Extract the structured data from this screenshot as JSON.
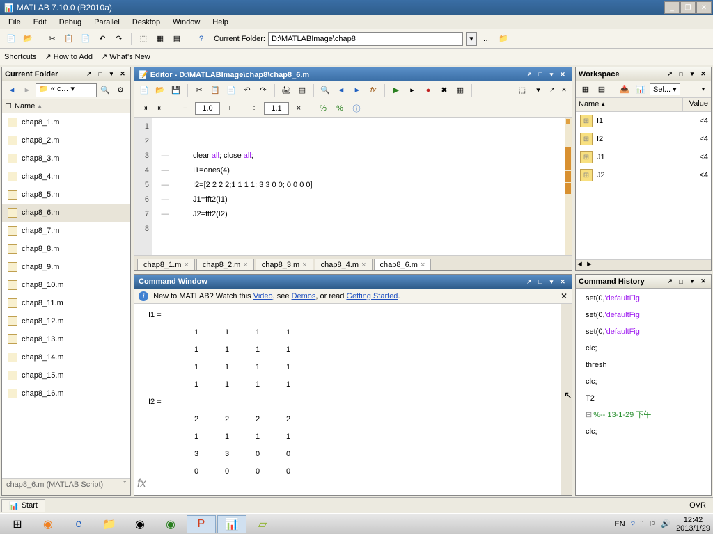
{
  "titlebar": {
    "icon": "matlab-icon",
    "text": "MATLAB 7.10.0 (R2010a)"
  },
  "menubar": [
    "File",
    "Edit",
    "Debug",
    "Parallel",
    "Desktop",
    "Window",
    "Help"
  ],
  "toolbar": {
    "folder_label": "Current Folder:",
    "folder_path": "D:\\MATLABImage\\chap8"
  },
  "shortcuts": {
    "label": "Shortcuts",
    "how": "How to Add",
    "whats": "What's New"
  },
  "current_folder": {
    "title": "Current Folder",
    "path_display": "« c…",
    "col": "Name",
    "files": [
      "chap8_1.m",
      "chap8_2.m",
      "chap8_3.m",
      "chap8_4.m",
      "chap8_5.m",
      "chap8_6.m",
      "chap8_7.m",
      "chap8_8.m",
      "chap8_9.m",
      "chap8_10.m",
      "chap8_11.m",
      "chap8_12.m",
      "chap8_13.m",
      "chap8_14.m",
      "chap8_15.m",
      "chap8_16.m"
    ],
    "selected": "chap8_6.m",
    "detail": "chap8_6.m (MATLAB Script)"
  },
  "editor": {
    "title": "Editor - D:\\MATLABImage\\chap8\\chap8_6.m",
    "zoom1": "1.0",
    "zoom2": "1.1",
    "lines": [
      {
        "n": 1,
        "dash": "",
        "text": ""
      },
      {
        "n": 2,
        "dash": "",
        "text": ""
      },
      {
        "n": 3,
        "dash": "—",
        "pre": "clear ",
        "str1": "all",
        "mid": "; close ",
        "str2": "all",
        "post": ";"
      },
      {
        "n": 4,
        "dash": "—",
        "text": "I1=ones(4)"
      },
      {
        "n": 5,
        "dash": "—",
        "text": "I2=[2 2 2 2;1 1 1 1; 3 3 0 0; 0 0 0 0]"
      },
      {
        "n": 6,
        "dash": "—",
        "text": "J1=fft2(I1)"
      },
      {
        "n": 7,
        "dash": "—",
        "text": "J2=fft2(I2)"
      },
      {
        "n": 8,
        "dash": "",
        "text": ""
      }
    ],
    "tabs": [
      "chap8_1.m",
      "chap8_2.m",
      "chap8_3.m",
      "chap8_4.m",
      "chap8_6.m"
    ],
    "active_tab": "chap8_6.m"
  },
  "command_window": {
    "title": "Command Window",
    "info_pre": "New to MATLAB? Watch this ",
    "info_link1": "Video",
    "info_mid1": ", see ",
    "info_link2": "Demos",
    "info_mid2": ", or read ",
    "info_link3": "Getting Started",
    "info_post": ".",
    "output": [
      {
        "type": "header",
        "text": "I1 ="
      },
      {
        "type": "row",
        "vals": [
          "1",
          "1",
          "1",
          "1"
        ]
      },
      {
        "type": "row",
        "vals": [
          "1",
          "1",
          "1",
          "1"
        ]
      },
      {
        "type": "row",
        "vals": [
          "1",
          "1",
          "1",
          "1"
        ]
      },
      {
        "type": "row",
        "vals": [
          "1",
          "1",
          "1",
          "1"
        ]
      },
      {
        "type": "header",
        "text": "I2 ="
      },
      {
        "type": "row",
        "vals": [
          "2",
          "2",
          "2",
          "2"
        ]
      },
      {
        "type": "row",
        "vals": [
          "1",
          "1",
          "1",
          "1"
        ]
      },
      {
        "type": "row",
        "vals": [
          "3",
          "3",
          "0",
          "0"
        ]
      },
      {
        "type": "row",
        "vals": [
          "0",
          "0",
          "0",
          "0"
        ]
      }
    ],
    "fx": "fx"
  },
  "workspace": {
    "title": "Workspace",
    "sel_label": "Sel...",
    "cols": {
      "name": "Name",
      "val": "Value"
    },
    "vars": [
      {
        "name": "I1",
        "val": "<4"
      },
      {
        "name": "I2",
        "val": "<4"
      },
      {
        "name": "J1",
        "val": "<4"
      },
      {
        "name": "J2",
        "val": "<4"
      }
    ]
  },
  "history": {
    "title": "Command History",
    "lines": [
      {
        "text": "set(0,",
        "hl": "'defaultFig"
      },
      {
        "text": "set(0,",
        "hl": "'defaultFig"
      },
      {
        "text": "set(0,",
        "hl": "'defaultFig"
      },
      {
        "text": "clc;"
      },
      {
        "text": "thresh"
      },
      {
        "text": "clc;"
      },
      {
        "text": "T2"
      },
      {
        "date": true,
        "text": "%-- 13-1-29  下午"
      },
      {
        "text": "clc;"
      }
    ]
  },
  "status": {
    "start": "Start",
    "ovr": "OVR"
  },
  "taskbar": {
    "lang": "EN",
    "time": "12:42",
    "date": "2013/1/29"
  }
}
